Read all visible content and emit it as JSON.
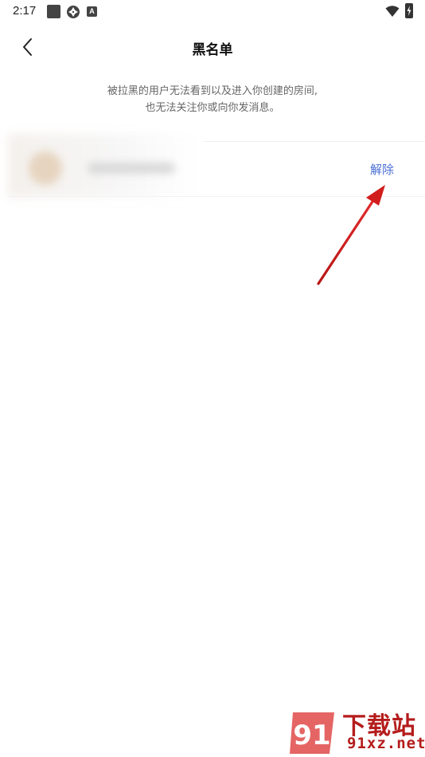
{
  "status_bar": {
    "time": "2:17",
    "icons": [
      "square-icon",
      "shutter-icon",
      "a-badge-icon",
      "wifi-icon",
      "battery-charging-icon"
    ],
    "a_badge": "A"
  },
  "header": {
    "title": "黑名单",
    "back_icon": "chevron-left-icon"
  },
  "notice": {
    "line1": "被拉黑的用户无法看到以及进入你创建的房间,",
    "line2": "也无法关注你或向你发消息。"
  },
  "blocked_users": [
    {
      "unblock_label": "解除"
    }
  ],
  "annotation": {
    "arrow_color": "#d21d1d"
  },
  "watermark": {
    "title": "下载站",
    "domain": "91xz.net",
    "logo_text": "91",
    "color": "#b51c1c"
  },
  "colors": {
    "accent": "#4a6fd4",
    "text_secondary": "#666666"
  }
}
